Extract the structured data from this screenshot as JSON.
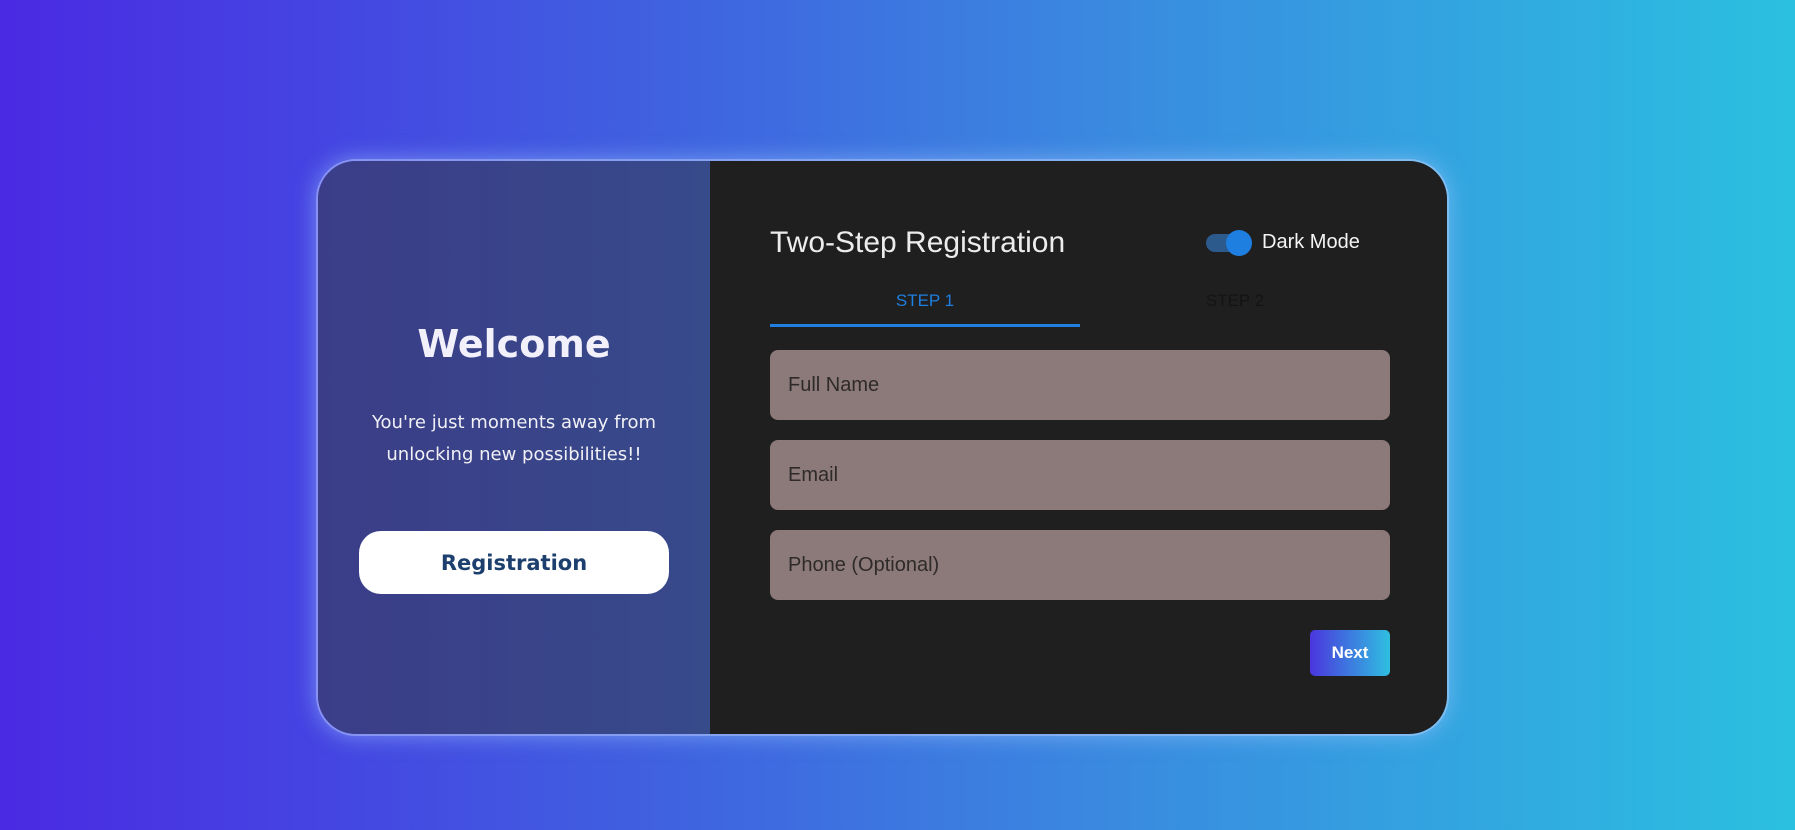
{
  "welcome": {
    "title": "Welcome",
    "message": "You're just moments away from unlocking new possibilities!!",
    "register_button_label": "Registration"
  },
  "form": {
    "title": "Two-Step Registration",
    "theme_toggle": {
      "label": "Dark Mode",
      "enabled": true
    },
    "tabs": [
      {
        "label": "STEP 1",
        "active": true
      },
      {
        "label": "STEP 2",
        "active": false
      }
    ],
    "fields": {
      "full_name": {
        "placeholder": "Full Name",
        "value": ""
      },
      "email": {
        "placeholder": "Email",
        "value": ""
      },
      "phone": {
        "placeholder": "Phone (Optional)",
        "value": ""
      }
    },
    "next_button_label": "Next"
  },
  "colors": {
    "accent": "#1e7fe0",
    "panel_dark": "#1f1f1f",
    "input_bg": "#8c7a7a"
  }
}
